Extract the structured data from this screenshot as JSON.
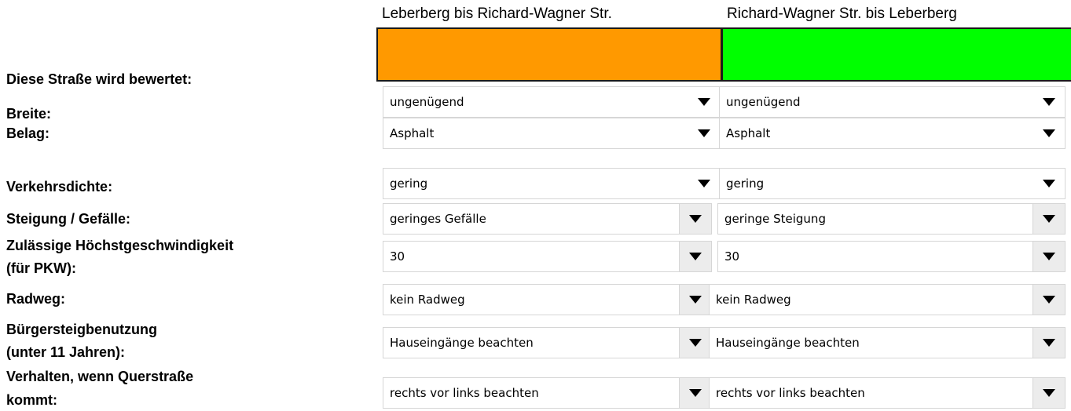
{
  "headers": {
    "left": "Leberberg bis Richard-Wagner Str.",
    "right": "Richard-Wagner Str. bis Leberberg"
  },
  "labels": {
    "rated": "Diese Straße wird bewertet:",
    "breite": "Breite:",
    "belag": "Belag:",
    "verkehrsdichte": "Verkehrsdichte:",
    "steigung": "Steigung / Gefälle:",
    "speed_line1": "Zulässige Höchstgeschwindigkeit",
    "speed_line2": "(für PKW):",
    "radweg": "Radweg:",
    "sidewalk_line1": "Bürgersteigbenutzung",
    "sidewalk_line2": "(unter 11 Jahren):",
    "cross_line1": "Verhalten, wenn Querstraße",
    "cross_line2": "kommt:"
  },
  "colors": {
    "left_rating": "#ff9900",
    "right_rating": "#00ff00"
  },
  "dropdown_icon": "triangle-down-icon",
  "fields": {
    "breite": {
      "left": "ungenügend",
      "right": "ungenügend"
    },
    "belag": {
      "left": "Asphalt",
      "right": "Asphalt"
    },
    "verkehrsdichte": {
      "left": "gering",
      "right": "gering"
    },
    "steigung": {
      "left": "geringes Gefälle",
      "right": "geringe Steigung"
    },
    "speed": {
      "left": "30",
      "right": "30"
    },
    "radweg": {
      "left": "kein Radweg",
      "right": "kein Radweg"
    },
    "sidewalk": {
      "left": "Hauseingänge beachten",
      "right": "Hauseingänge beachten"
    },
    "cross": {
      "left": "rechts vor links beachten",
      "right": "rechts vor links beachten"
    }
  }
}
